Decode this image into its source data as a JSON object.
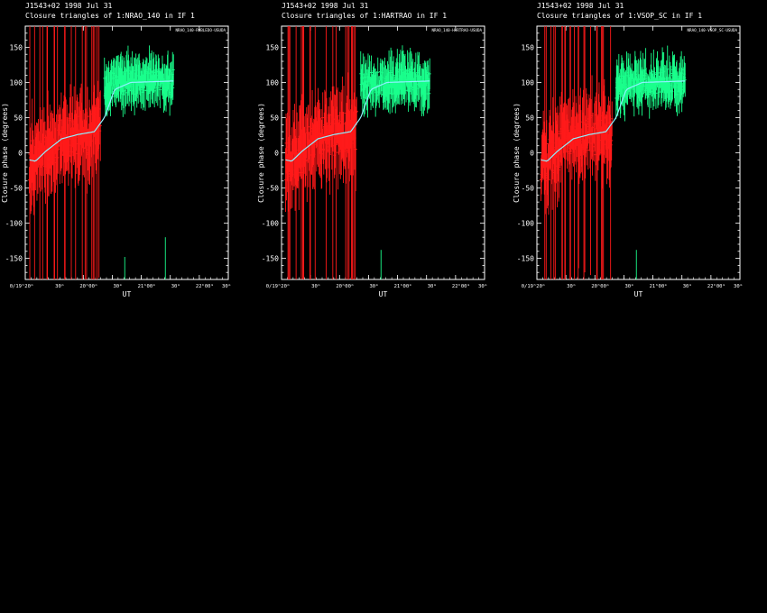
{
  "chart_data": [
    {
      "type": "line",
      "header": "J1543+02   1998 Jul 31",
      "title": "Closure triangles of 1:NRAO_140 in IF 1",
      "legend_text": "NRAO_140-ROBLEDO-USUDA",
      "xlabel": "UT",
      "ylabel": "Closure phase   (degrees)",
      "xlim": [
        0,
        1
      ],
      "ylim": [
        -180,
        180
      ],
      "yticks": [
        -150,
        -100,
        -50,
        0,
        50,
        100,
        150
      ],
      "xtick_labels": [
        "0/19ʰ20ᵐ",
        "30ᵐ",
        "20ʰ00ᵐ",
        "30ᵐ",
        "21ʰ00ᵐ",
        "30ᵐ",
        "22ʰ00ᵐ",
        "30ᵐ"
      ],
      "colors": {
        "segment1": "#ff1a1a",
        "segment2": "#1aff8c",
        "model": "#8ef0ff"
      },
      "segments": [
        {
          "t": [
            0.02,
            0.37
          ],
          "trend": [
            [
              0.02,
              -10
            ],
            [
              0.06,
              -10
            ],
            [
              0.15,
              15
            ],
            [
              0.25,
              25
            ],
            [
              0.33,
              28
            ],
            [
              0.37,
              35
            ]
          ],
          "noise": 30
        },
        {
          "t": [
            0.39,
            0.73
          ],
          "trend": [
            [
              0.39,
              95
            ],
            [
              0.5,
              100
            ],
            [
              0.6,
              102
            ],
            [
              0.73,
              100
            ]
          ],
          "noise": 18
        }
      ],
      "model_curve": [
        [
          0.02,
          -10
        ],
        [
          0.05,
          -12
        ],
        [
          0.1,
          2
        ],
        [
          0.18,
          20
        ],
        [
          0.26,
          26
        ],
        [
          0.34,
          30
        ],
        [
          0.39,
          50
        ],
        [
          0.44,
          90
        ],
        [
          0.52,
          100
        ],
        [
          0.73,
          102
        ]
      ],
      "stray_points": [
        {
          "t": 0.49,
          "y": -148
        },
        {
          "t": 0.69,
          "y": -120
        }
      ]
    },
    {
      "type": "line",
      "header": "J1543+02   1998 Jul 31",
      "title": "Closure triangles of 1:HARTRAO in IF 1",
      "legend_text": "NRAO_140-HARTRAO-USUDA",
      "xlabel": "UT",
      "ylabel": "Closure phase   (degrees)",
      "xlim": [
        0,
        1
      ],
      "ylim": [
        -180,
        180
      ],
      "yticks": [
        -150,
        -100,
        -50,
        0,
        50,
        100,
        150
      ],
      "xtick_labels": [
        "0/19ʰ20ᵐ",
        "30ᵐ",
        "20ʰ00ᵐ",
        "30ᵐ",
        "21ʰ00ᵐ",
        "30ᵐ",
        "22ʰ00ᵐ",
        "30ᵐ"
      ],
      "colors": {
        "segment1": "#ff1a1a",
        "segment2": "#1aff8c",
        "model": "#8ef0ff"
      },
      "segments": [
        {
          "t": [
            0.02,
            0.37
          ],
          "trend": [
            [
              0.02,
              -10
            ],
            [
              0.06,
              -10
            ],
            [
              0.15,
              15
            ],
            [
              0.25,
              25
            ],
            [
              0.33,
              28
            ],
            [
              0.37,
              35
            ]
          ],
          "noise": 30
        },
        {
          "t": [
            0.39,
            0.73
          ],
          "trend": [
            [
              0.39,
              95
            ],
            [
              0.5,
              100
            ],
            [
              0.6,
              102
            ],
            [
              0.73,
              100
            ]
          ],
          "noise": 18
        }
      ],
      "model_curve": [
        [
          0.02,
          -10
        ],
        [
          0.05,
          -12
        ],
        [
          0.1,
          2
        ],
        [
          0.18,
          20
        ],
        [
          0.26,
          26
        ],
        [
          0.34,
          30
        ],
        [
          0.39,
          50
        ],
        [
          0.44,
          90
        ],
        [
          0.52,
          100
        ],
        [
          0.73,
          102
        ]
      ],
      "stray_points": [
        {
          "t": 0.49,
          "y": -138
        }
      ]
    },
    {
      "type": "line",
      "header": "J1543+02   1998 Jul 31",
      "title": "Closure triangles of 1:VSOP_SC in IF 1",
      "legend_text": "NRAO_140-VSOP_SC-USUDA",
      "xlabel": "UT",
      "ylabel": "Closure phase   (degrees)",
      "xlim": [
        0,
        1
      ],
      "ylim": [
        -180,
        180
      ],
      "yticks": [
        -150,
        -100,
        -50,
        0,
        50,
        100,
        150
      ],
      "xtick_labels": [
        "0/19ʰ20ᵐ",
        "30ᵐ",
        "20ʰ00ᵐ",
        "30ᵐ",
        "21ʰ00ᵐ",
        "30ᵐ",
        "22ʰ00ᵐ",
        "30ᵐ"
      ],
      "colors": {
        "segment1": "#ff1a1a",
        "segment2": "#1aff8c",
        "model": "#8ef0ff"
      },
      "segments": [
        {
          "t": [
            0.02,
            0.37
          ],
          "trend": [
            [
              0.02,
              -10
            ],
            [
              0.06,
              -10
            ],
            [
              0.15,
              15
            ],
            [
              0.25,
              25
            ],
            [
              0.33,
              28
            ],
            [
              0.37,
              35
            ]
          ],
          "noise": 30
        },
        {
          "t": [
            0.39,
            0.73
          ],
          "trend": [
            [
              0.39,
              95
            ],
            [
              0.5,
              100
            ],
            [
              0.6,
              102
            ],
            [
              0.73,
              100
            ]
          ],
          "noise": 18
        }
      ],
      "model_curve": [
        [
          0.02,
          -10
        ],
        [
          0.05,
          -12
        ],
        [
          0.1,
          2
        ],
        [
          0.18,
          20
        ],
        [
          0.26,
          26
        ],
        [
          0.34,
          30
        ],
        [
          0.39,
          50
        ],
        [
          0.44,
          90
        ],
        [
          0.52,
          100
        ],
        [
          0.73,
          102
        ]
      ],
      "stray_points": [
        {
          "t": 0.49,
          "y": -138
        }
      ]
    }
  ]
}
